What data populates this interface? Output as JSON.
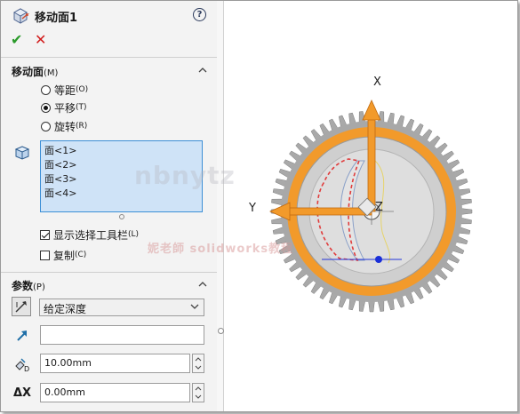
{
  "header": {
    "title": "移动面1",
    "help": "?"
  },
  "actions": {
    "ok": "✔",
    "cancel": "✕"
  },
  "move_face": {
    "title": "移动面",
    "shortcut": "(M)",
    "options": [
      {
        "label": "等距",
        "key": "(O)",
        "selected": false
      },
      {
        "label": "平移",
        "key": "(T)",
        "selected": true
      },
      {
        "label": "旋转",
        "key": "(R)",
        "selected": false
      }
    ],
    "faces": [
      "面<1>",
      "面<2>",
      "面<3>",
      "面<4>"
    ],
    "show_toolbar": {
      "label": "显示选择工具栏",
      "key": "(L)",
      "checked": true
    },
    "copy": {
      "label": "复制",
      "key": "(C)",
      "checked": false
    }
  },
  "parameters": {
    "title": "参数",
    "shortcut": "(P)",
    "end_condition": "给定深度",
    "direction_value": "",
    "depth": "10.00mm",
    "delta_x": "0.00mm",
    "delta_x_label": "ΔX"
  },
  "viewport": {
    "axis_x": "X",
    "axis_y": "Y",
    "axis_z": "Z",
    "watermark": "nbnytz",
    "watermark_sub": "妮老師 solidworks教程",
    "colors": {
      "gear": "#a9a9a9",
      "ring": "#f29a2b",
      "arrow": "#f29a2b",
      "selection": "#e03c3c"
    }
  }
}
